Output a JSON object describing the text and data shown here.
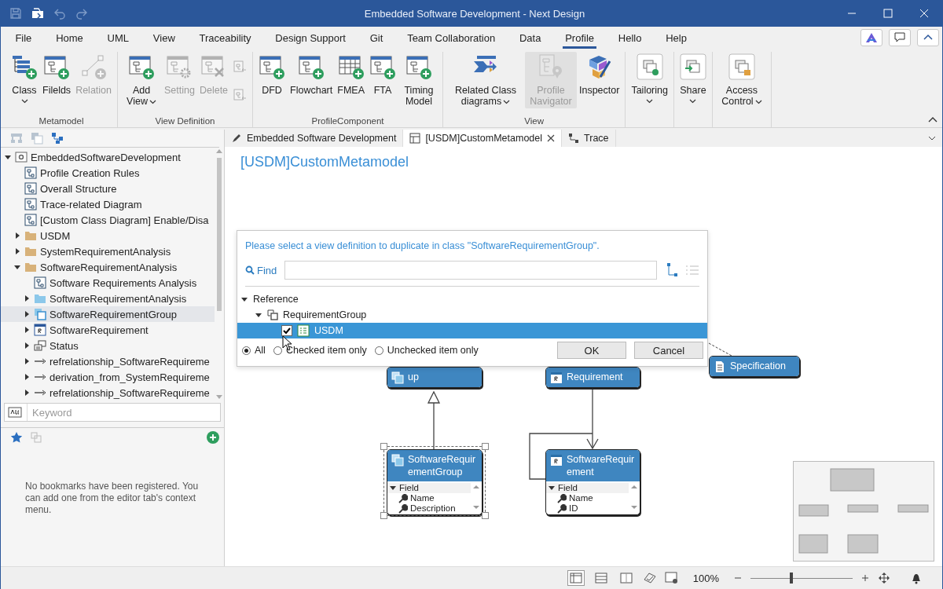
{
  "window": {
    "title": "Embedded Software Development - Next Design"
  },
  "quick_access": [
    {
      "disabled": true
    },
    {
      "disabled": false
    },
    {
      "disabled": true
    },
    {
      "disabled": true
    }
  ],
  "menu_tabs": [
    {
      "label": "File",
      "selected": false
    },
    {
      "label": "Home",
      "selected": false
    },
    {
      "label": "UML",
      "selected": false
    },
    {
      "label": "View",
      "selected": false
    },
    {
      "label": "Traceability",
      "selected": false
    },
    {
      "label": "Design Support",
      "selected": false
    },
    {
      "label": "Git",
      "selected": false
    },
    {
      "label": "Team Collaboration",
      "selected": false
    },
    {
      "label": "Data",
      "selected": false
    },
    {
      "label": "Profile",
      "selected": true
    },
    {
      "label": "Hello",
      "selected": false
    },
    {
      "label": "Help",
      "selected": false
    }
  ],
  "ribbon": {
    "groups": [
      {
        "title": "Metamodel",
        "buttons": [
          {
            "label": "Class",
            "dropdown": true,
            "disabled": false,
            "highlighted": false
          },
          {
            "label": "Filelds",
            "dropdown": false,
            "disabled": false,
            "highlighted": false
          },
          {
            "label": "Relation",
            "dropdown": false,
            "disabled": true,
            "highlighted": false
          }
        ]
      },
      {
        "title": "View Definition",
        "buttons": [
          {
            "label": "Add View",
            "dropdown": true,
            "disabled": false,
            "highlighted": false
          },
          {
            "label": "Setting",
            "dropdown": false,
            "disabled": true,
            "highlighted": false
          },
          {
            "label": "Delete",
            "dropdown": false,
            "disabled": true,
            "highlighted": false
          }
        ],
        "small_buttons": [
          {
            "disabled": true
          },
          {
            "disabled": true
          }
        ]
      },
      {
        "title": "ProfileComponent",
        "buttons": [
          {
            "label": "DFD",
            "dropdown": false,
            "disabled": false,
            "highlighted": false
          },
          {
            "label": "Flowchart",
            "dropdown": false,
            "disabled": false,
            "highlighted": false
          },
          {
            "label": "FMEA",
            "dropdown": false,
            "disabled": false,
            "highlighted": false
          },
          {
            "label": "FTA",
            "dropdown": false,
            "disabled": false,
            "highlighted": false
          },
          {
            "label": "Timing Model",
            "dropdown": false,
            "disabled": false,
            "highlighted": false
          }
        ]
      },
      {
        "title": "View",
        "buttons": [
          {
            "label": "Related Class diagrams",
            "dropdown": true,
            "disabled": false,
            "highlighted": false
          },
          {
            "label": "Profile Navigator",
            "dropdown": false,
            "disabled": true,
            "highlighted": true
          },
          {
            "label": "Inspector",
            "dropdown": false,
            "disabled": false,
            "highlighted": false
          }
        ]
      },
      {
        "buttons": [
          {
            "label": "Tailoring",
            "dropdown": true,
            "disabled": false,
            "highlighted": false
          }
        ]
      },
      {
        "buttons": [
          {
            "label": "Share",
            "dropdown": true,
            "disabled": false,
            "highlighted": false
          }
        ]
      },
      {
        "buttons": [
          {
            "label": "Access Control",
            "dropdown": true,
            "disabled": false,
            "highlighted": false
          }
        ]
      }
    ]
  },
  "explorer": {
    "toolbar": [
      {
        "disabled": true
      },
      {
        "disabled": true
      },
      {
        "disabled": false
      }
    ],
    "tree": [
      {
        "label": "EmbeddedSoftwareDevelopment",
        "kind": "project",
        "expanded": true,
        "selected": false,
        "children": [
          {
            "label": "Profile Creation Rules",
            "kind": "diagram",
            "selected": false
          },
          {
            "label": "Overall Structure",
            "kind": "diagram",
            "selected": false
          },
          {
            "label": "Trace-related Diagram",
            "kind": "diagram",
            "selected": false
          },
          {
            "label": "[Custom Class Diagram] Enable/Disa",
            "kind": "diagram",
            "selected": false
          },
          {
            "label": "USDM",
            "kind": "folder",
            "expanded": false,
            "selected": false
          },
          {
            "label": "SystemRequirementAnalysis",
            "kind": "folder",
            "expanded": false,
            "selected": false
          },
          {
            "label": "SoftwareRequirementAnalysis",
            "kind": "folder",
            "expanded": true,
            "selected": false,
            "children": [
              {
                "label": "Software Requirements Analysis",
                "kind": "diagram",
                "selected": false
              },
              {
                "label": "SoftwareRequirementAnalysis",
                "kind": "package",
                "expanded": false,
                "selected": false
              },
              {
                "label": "SoftwareRequirementGroup",
                "kind": "group",
                "expanded": false,
                "selected": true
              },
              {
                "label": "SoftwareRequirement",
                "kind": "class",
                "expanded": false,
                "selected": false
              },
              {
                "label": "Status",
                "kind": "enum",
                "expanded": false,
                "selected": false
              },
              {
                "label": "refrelationship_SoftwareRequireme",
                "kind": "relation",
                "expanded": false,
                "selected": false
              },
              {
                "label": "derivation_from_SystemRequireme",
                "kind": "relation",
                "expanded": false,
                "selected": false
              },
              {
                "label": "refrelationship_SoftwareRequireme",
                "kind": "relation",
                "expanded": false,
                "selected": false
              }
            ]
          }
        ]
      }
    ],
    "search": {
      "placeholder": "Keyword"
    }
  },
  "bookmarks": {
    "message": "No bookmarks have been registered. You can add one from the editor tab's context menu."
  },
  "editor_tabs": [
    {
      "label": "Embedded Software Development",
      "selected": false
    },
    {
      "label": "[USDM]CustomMetamodel",
      "selected": true
    },
    {
      "label": "Trace",
      "selected": false
    }
  ],
  "editor": {
    "title": "[USDM]CustomMetamodel",
    "nodes": [
      {
        "kind": "group",
        "title": "up",
        "selected": false
      },
      {
        "kind": "class",
        "title": "Requirement",
        "selected": false
      },
      {
        "kind": "spec",
        "title": "Specification",
        "selected": false
      },
      {
        "kind": "group",
        "title": "SoftwareRequirementGroup",
        "selected": true,
        "fields_header": "Field",
        "fields": [
          "Name",
          "Description"
        ]
      },
      {
        "kind": "class",
        "title": "SoftwareRequirement",
        "selected": false,
        "fields_header": "Field",
        "fields": [
          "Name",
          "ID"
        ]
      }
    ]
  },
  "dialog": {
    "message": "Please select a view definition to duplicate in class \"SoftwareRequirementGroup\".",
    "find_label": "Find",
    "tree": [
      {
        "label": "Reference",
        "expanded": true,
        "selected": false,
        "children": [
          {
            "label": "RequirementGroup",
            "kind": "class",
            "expanded": true,
            "selected": false,
            "children": [
              {
                "label": "USDM",
                "kind": "view",
                "checked": true,
                "selected": true
              }
            ]
          }
        ]
      }
    ],
    "filters": [
      {
        "label": "All",
        "selected": true
      },
      {
        "label": "Checked item only",
        "selected": false
      },
      {
        "label": "Unchecked item only",
        "selected": false
      }
    ],
    "buttons": [
      "OK",
      "Cancel"
    ]
  },
  "status_bar": {
    "layouts": [
      {
        "selected": true
      },
      {
        "selected": false
      },
      {
        "selected": false
      }
    ],
    "zoom": "100%",
    "zoom_slider": {
      "level": 0.4
    }
  }
}
